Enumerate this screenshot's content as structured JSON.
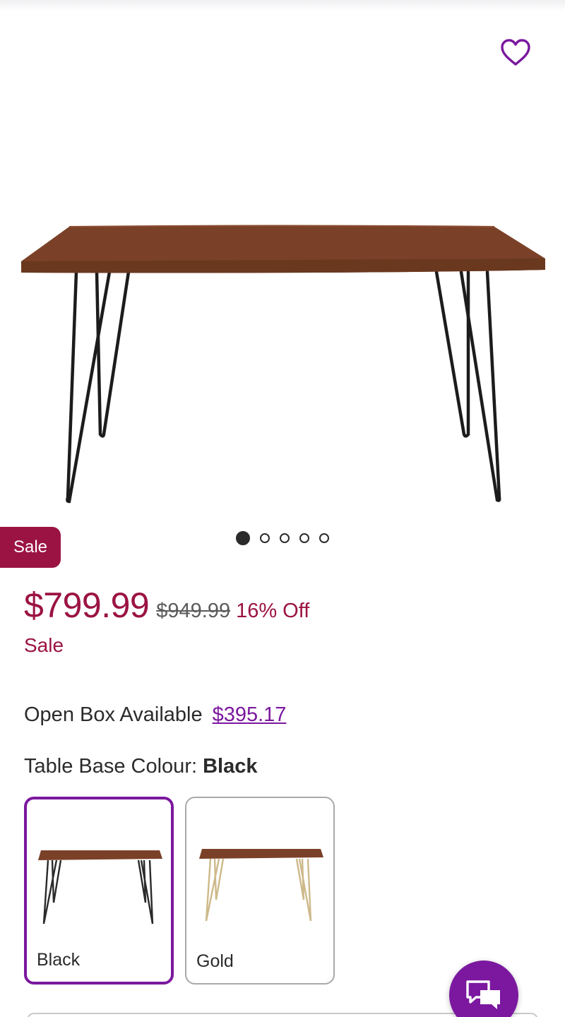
{
  "gallery": {
    "image_count": 5,
    "active_index": 0
  },
  "badge": {
    "sale": "Sale"
  },
  "pricing": {
    "current": "$799.99",
    "was": "$949.99",
    "discount": "16% Off",
    "label": "Sale"
  },
  "open_box": {
    "label": "Open Box Available",
    "price": "$395.17"
  },
  "colour": {
    "title": "Table Base Colour:",
    "selected": "Black",
    "options": [
      {
        "label": "Black",
        "leg_color": "#2a2a2a"
      },
      {
        "label": "Gold",
        "leg_color": "#cdb98a"
      }
    ]
  },
  "icons": {
    "favorite": "heart-outline-icon",
    "chat": "chat-bubbles-icon"
  },
  "colors": {
    "accent": "#7b189f",
    "sale": "#9b1343",
    "wood": "#7a4128"
  }
}
